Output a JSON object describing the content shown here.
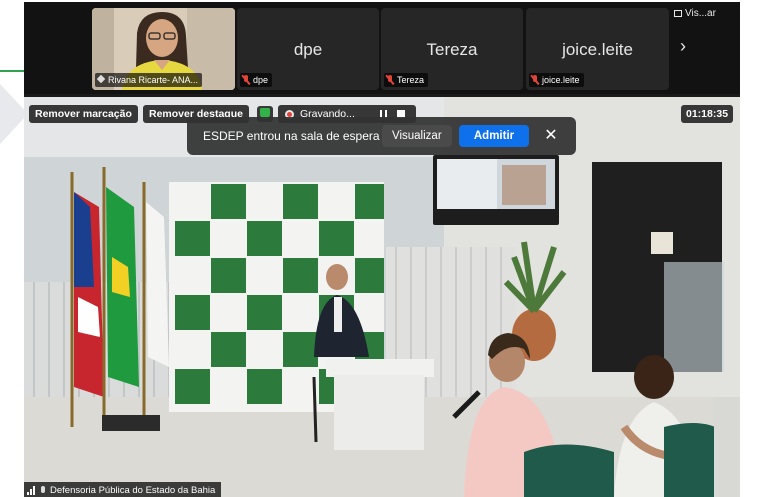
{
  "participants": [
    {
      "display_name": "",
      "label": "Rivana Ricarte- ANA...",
      "has_video": true,
      "muted": false
    },
    {
      "display_name": "dpe",
      "label": "dpe",
      "has_video": false,
      "muted": true
    },
    {
      "display_name": "Tereza",
      "label": "Tereza",
      "has_video": false,
      "muted": true
    },
    {
      "display_name": "joice.leite",
      "label": "joice.leite",
      "has_video": false,
      "muted": true
    }
  ],
  "view_control": {
    "label": "Vis...ar",
    "icon": "grid-view-icon"
  },
  "next_arrow": "›",
  "toolbar": {
    "remove_mark": "Remover marcação",
    "remove_highlight": "Remover destaque",
    "recording": "Gravando...",
    "timer": "01:18:35"
  },
  "waiting_room": {
    "message": "ESDEP entrou na sala de espera",
    "view_button": "Visualizar",
    "admit_button": "Admitir",
    "close": "✕"
  },
  "active_speaker": {
    "label": "Defensoria Pública do Estado da Bahia"
  },
  "colors": {
    "admit_blue": "#0e71eb",
    "muted_red": "#e0453a",
    "shield_green": "#33b24a",
    "backdrop_green": "#2d7a3d"
  }
}
